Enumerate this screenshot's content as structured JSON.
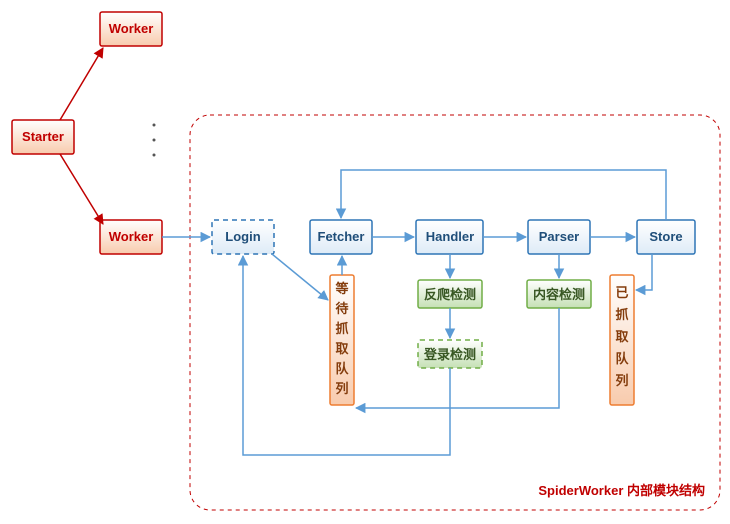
{
  "nodes": {
    "worker_top": "Worker",
    "starter": "Starter",
    "worker_bottom": "Worker",
    "login": "Login",
    "fetcher": "Fetcher",
    "handler": "Handler",
    "parser": "Parser",
    "store": "Store",
    "queue_wait": [
      "等",
      "待",
      "抓",
      "取",
      "队",
      "列"
    ],
    "anti_crawl": "反爬检测",
    "login_check": "登录检测",
    "content_check": "内容检测",
    "queue_done": [
      "已",
      "抓",
      "取",
      "队",
      "列"
    ]
  },
  "caption": "SpiderWorker 内部模块结构",
  "colors": {
    "red_border": "#c00000",
    "red_fill": "#fbe5d6",
    "blue_border": "#2e75b6",
    "blue_fill": "#deebf7",
    "green_border": "#70ad47",
    "green_fill": "#e2f0d9",
    "orange_border": "#ed7d31",
    "orange_fill": "#fbe5d6",
    "arrow": "#5b9bd5",
    "arrow_red": "#c00000",
    "dash_red": "#c00000"
  }
}
